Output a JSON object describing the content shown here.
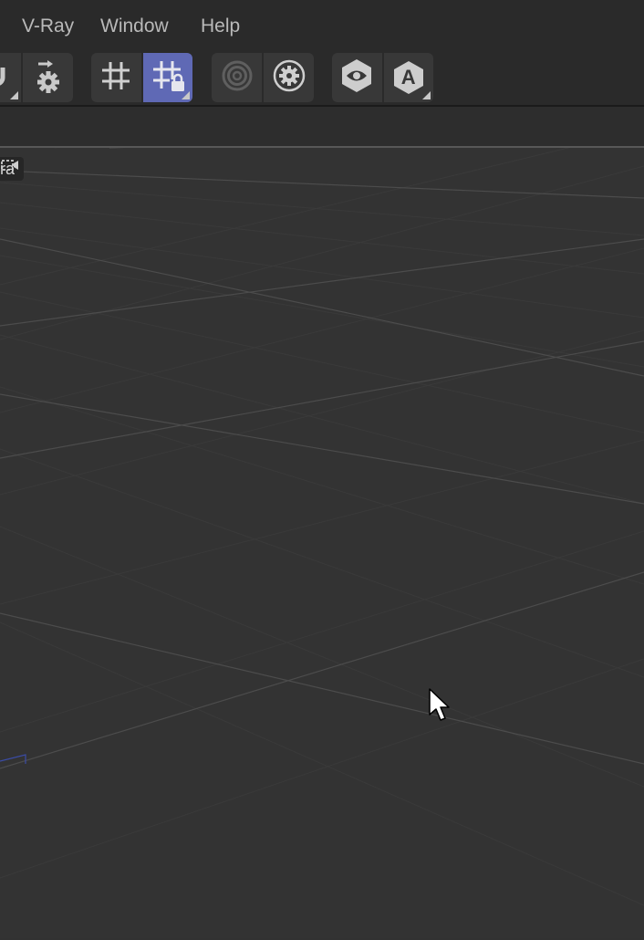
{
  "menubar": {
    "items": [
      {
        "label": "V-Ray"
      },
      {
        "label": "Window"
      },
      {
        "label": "Help"
      }
    ]
  },
  "toolbar": {
    "groups": [
      {
        "buttons": [
          {
            "icon": "magnet-icon",
            "active": false
          },
          {
            "icon": "step-gear-icon",
            "active": false
          }
        ]
      },
      {
        "buttons": [
          {
            "icon": "grid-hash-icon",
            "active": false
          },
          {
            "icon": "grid-lock-icon",
            "active": true
          }
        ]
      },
      {
        "buttons": [
          {
            "icon": "rings-icon",
            "active": false
          },
          {
            "icon": "gear-circle-icon",
            "active": false
          }
        ]
      },
      {
        "buttons": [
          {
            "icon": "eye-hex-icon",
            "active": false
          },
          {
            "icon": "letter-a-hex-icon",
            "active": false
          }
        ]
      }
    ],
    "letter_a": "A"
  },
  "viewport": {
    "camera_label": "ra"
  },
  "colors": {
    "menubar_bg": "#2a2a2a",
    "viewport_bg": "#333333",
    "active_button": "#5f69b5",
    "grid_major": "#4a4a4a",
    "grid_minor": "#3a3a3a"
  }
}
